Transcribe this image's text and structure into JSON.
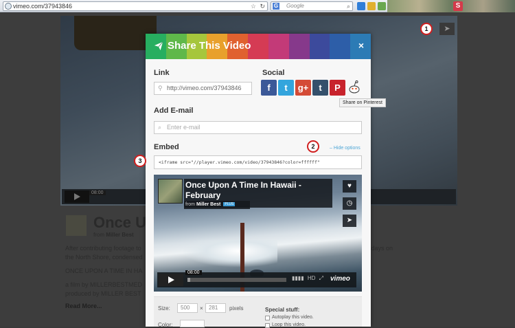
{
  "browser": {
    "url": "vimeo.com/37943846",
    "search_placeholder": "Google",
    "search_engine_letter": "G",
    "addon_letter": "S"
  },
  "background_page": {
    "video_time": "08:00",
    "title": "Once U",
    "from_label": "from",
    "author": "Miller Best",
    "paragraph_1": "After contributing footage to",
    "paragraph_1_end": "d I am left with, 20 days on",
    "paragraph_2": "the North Shore, condensed",
    "paragraph_3": "ONCE UPON A TIME IN HA",
    "paragraph_4": "a film by MILLERBESTMED",
    "paragraph_5": "produced by MILLER BEST",
    "read_more": "Read More..."
  },
  "modal": {
    "title": "Share This Video",
    "close_label": "×",
    "link_label": "Link",
    "link_value": "http://vimeo.com/37943846",
    "social_label": "Social",
    "social_buttons": [
      {
        "name": "facebook",
        "glyph": "f",
        "color": "#3b5998"
      },
      {
        "name": "twitter",
        "glyph": "t",
        "color": "#33a5dd"
      },
      {
        "name": "google-plus",
        "glyph": "g+",
        "color": "#d44b36"
      },
      {
        "name": "tumblr",
        "glyph": "t",
        "color": "#34506b"
      },
      {
        "name": "pinterest",
        "glyph": "P",
        "color": "#c8232c"
      }
    ],
    "tooltip": "Share on Pinterest",
    "email_label": "Add E-mail",
    "email_placeholder": "Enter e-mail",
    "embed_label": "Embed",
    "hide_options": "– Hide options",
    "embed_code": "<iframe src=\"//player.vimeo.com/video/37943846?color=ffffff\"",
    "header_colors": [
      "#27ae60",
      "#5fb84a",
      "#a6c63c",
      "#e8a02c",
      "#e0612f",
      "#d53b54",
      "#c33a78",
      "#86398b",
      "#3c4a9c",
      "#2d5ea8",
      "#2c7bb5"
    ]
  },
  "preview": {
    "title": "Once Upon A Time In Hawaii - February",
    "from_label": "from",
    "author": "Miller Best",
    "badge": "PLUS",
    "time": "08:00",
    "progress": 0.03,
    "hd_label": "HD",
    "logo": "vimeo"
  },
  "settings": {
    "size_label": "Size:",
    "width": "500",
    "times": "×",
    "height": "281",
    "units": "pixels",
    "color_label": "Color:",
    "special_label": "Special stuff:",
    "autoplay_label": "Autoplay this video.",
    "loop_label": "Loop this video."
  },
  "markers": [
    "1",
    "2",
    "3"
  ]
}
